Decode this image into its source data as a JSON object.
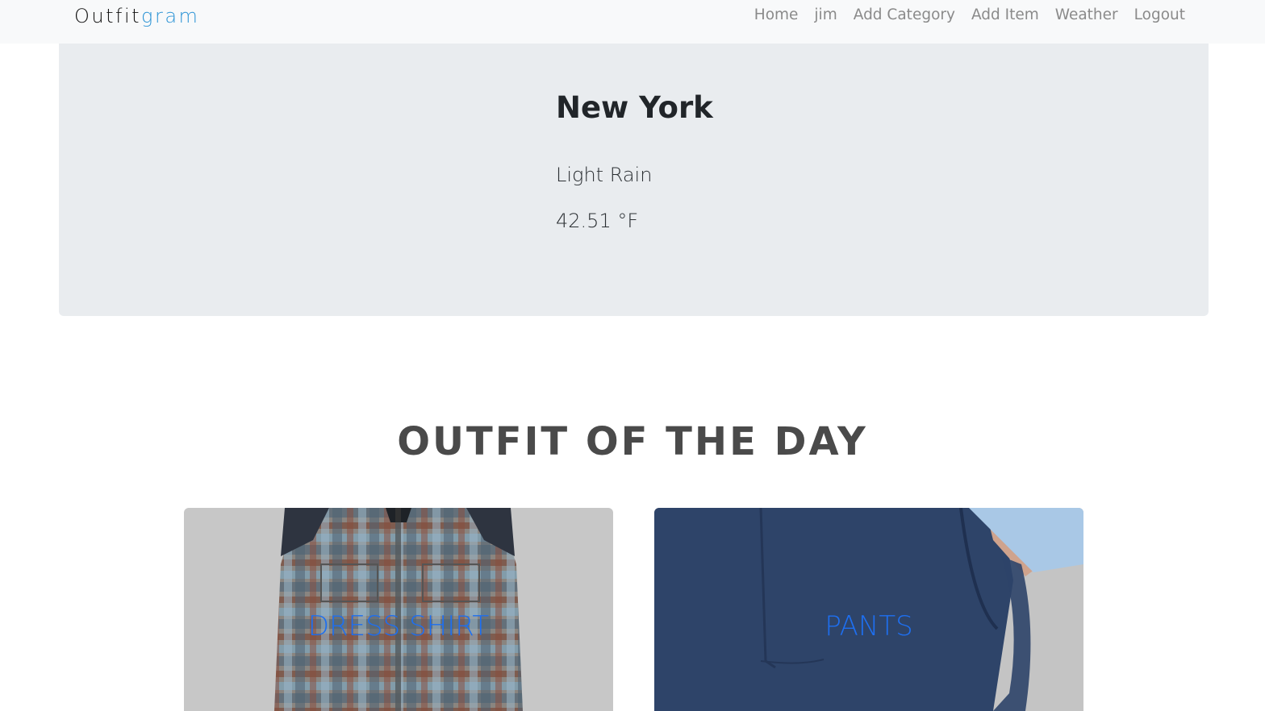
{
  "navbar": {
    "brand_dark": "Outfit",
    "brand_accent": "gram",
    "links": [
      "Home",
      "jim",
      "Add Category",
      "Add Item",
      "Weather",
      "Logout"
    ]
  },
  "weather": {
    "city": "New York",
    "condition": "Light Rain",
    "temperature": "42.51 °F"
  },
  "outfit": {
    "heading": "OUTFIT OF THE DAY",
    "items": [
      {
        "label": "DRESS SHIRT",
        "image": "plaid-flannel-shirt"
      },
      {
        "label": "PANTS",
        "image": "navy-trousers"
      }
    ]
  },
  "colors": {
    "navbar_bg": "#f8f9fa",
    "jumbotron_bg": "#e9ecef",
    "brand_accent": "#2f95d6",
    "card_label": "#1e6ff0"
  }
}
